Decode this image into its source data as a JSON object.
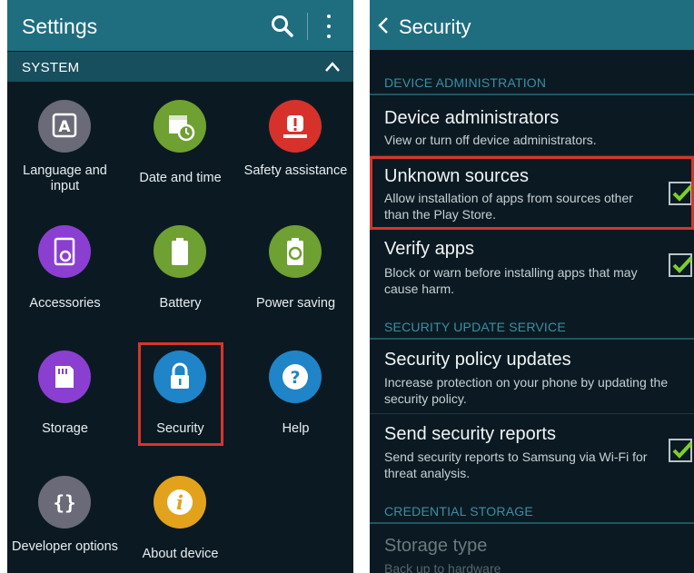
{
  "settings": {
    "title": "Settings",
    "section": "SYSTEM",
    "icons": {
      "search": "search-icon",
      "more": "more-vert-icon",
      "collapse": "chevron-up-icon"
    },
    "items": [
      {
        "label": "Language and input",
        "icon": "language-icon",
        "color": "#6b6a78"
      },
      {
        "label": "Date and time",
        "icon": "calendar-clock-icon",
        "color": "#6ea032"
      },
      {
        "label": "Safety assistance",
        "icon": "alert-icon",
        "color": "#d7312b"
      },
      {
        "label": "Accessories",
        "icon": "accessories-icon",
        "color": "#8b3fd0"
      },
      {
        "label": "Battery",
        "icon": "battery-icon",
        "color": "#6ea032"
      },
      {
        "label": "Power saving",
        "icon": "power-saving-icon",
        "color": "#6ea032"
      },
      {
        "label": "Storage",
        "icon": "sd-card-icon",
        "color": "#8b3fd0"
      },
      {
        "label": "Security",
        "icon": "lock-icon",
        "color": "#1f84c8"
      },
      {
        "label": "Help",
        "icon": "help-icon",
        "color": "#1f84c8"
      },
      {
        "label": "Developer options",
        "icon": "braces-icon",
        "color": "#6b6a78"
      },
      {
        "label": "About device",
        "icon": "info-icon",
        "color": "#e2a21b"
      }
    ],
    "highlighted_item": "Security"
  },
  "security": {
    "title": "Security",
    "back_icon": "back-arrow-icon",
    "sections": [
      {
        "header": "DEVICE ADMINISTRATION",
        "rows": [
          {
            "title": "Device administrators",
            "subtitle": "View or turn off device administrators."
          },
          {
            "title": "Unknown sources",
            "subtitle": "Allow installation of apps from sources other than the Play Store.",
            "checked": true,
            "highlighted": true
          },
          {
            "title": "Verify apps",
            "subtitle": "Block or warn before installing apps that may cause harm.",
            "checked": true
          }
        ]
      },
      {
        "header": "SECURITY UPDATE SERVICE",
        "rows": [
          {
            "title": "Security policy updates",
            "subtitle": "Increase protection on your phone by updating the security policy."
          },
          {
            "title": "Send security reports",
            "subtitle": "Send security reports to Samsung via Wi-Fi for threat analysis.",
            "checked": true
          }
        ]
      },
      {
        "header": "CREDENTIAL STORAGE",
        "rows": [
          {
            "title": "Storage type",
            "subtitle": "Back up to hardware",
            "disabled": true
          }
        ]
      }
    ]
  },
  "colors": {
    "background": "#0b1a22",
    "action_bar": "#1f6e80",
    "section_bar": "#174f5e",
    "section_text": "#3a8ea4",
    "checkmark": "#7cd02a",
    "highlight_box": "#d6362a"
  }
}
